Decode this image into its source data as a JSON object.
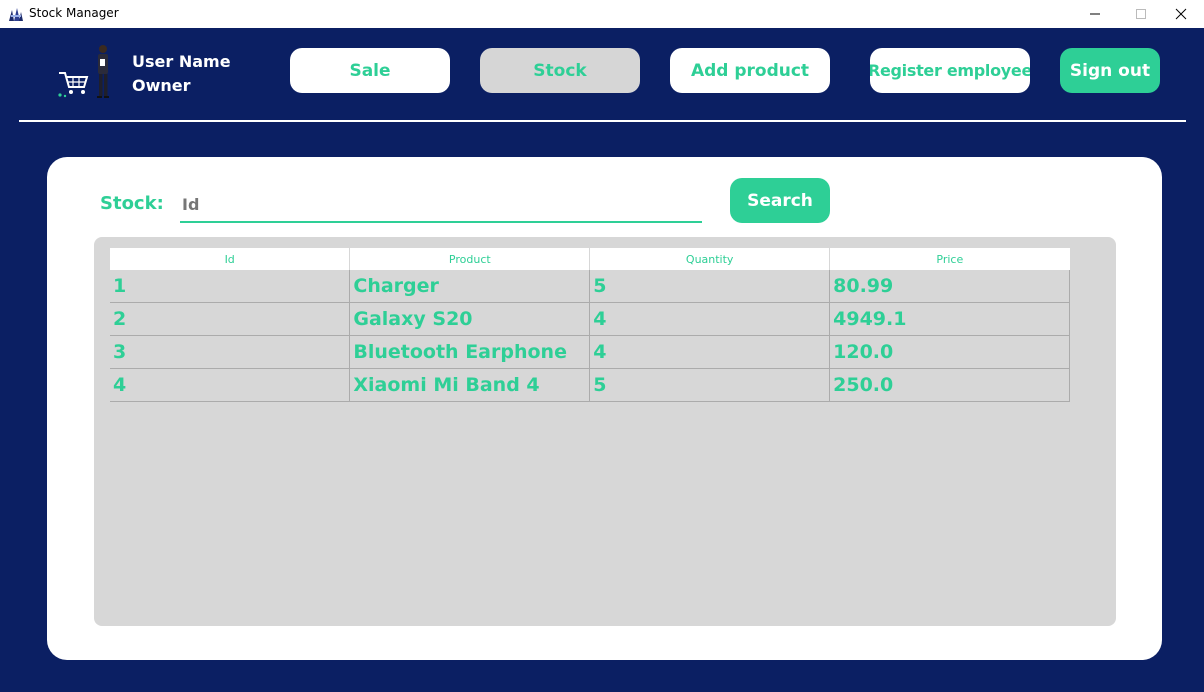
{
  "window": {
    "title": "Stock Manager",
    "controls": {
      "minimize": "—",
      "maximize": "☐",
      "close": "✕"
    }
  },
  "user": {
    "name": "User Name",
    "role": "Owner"
  },
  "nav": {
    "sale": "Sale",
    "stock": "Stock",
    "add_product": "Add product",
    "register_employee": "Register employee",
    "sign_out": "Sign out",
    "active": "Stock"
  },
  "search": {
    "label": "Stock:",
    "placeholder": "Id",
    "value": "",
    "button": "Search"
  },
  "table": {
    "columns": [
      "Id",
      "Product",
      "Quantity",
      "Price"
    ],
    "rows": [
      [
        "1",
        "Charger",
        "5",
        "80.99"
      ],
      [
        "2",
        "Galaxy S20",
        "4",
        "4949.1"
      ],
      [
        "3",
        "Bluetooth Earphone",
        "4",
        "120.0"
      ],
      [
        "4",
        "Xiaomi Mi Band 4",
        "5",
        "250.0"
      ]
    ]
  },
  "colors": {
    "background": "#0b1f63",
    "accent": "#2ecf96",
    "active_tab": "#d6d6d6",
    "table_panel": "#d7d7d7"
  },
  "icons": {
    "app": "app-logo-icon",
    "user": "user-with-cart-illustration"
  }
}
